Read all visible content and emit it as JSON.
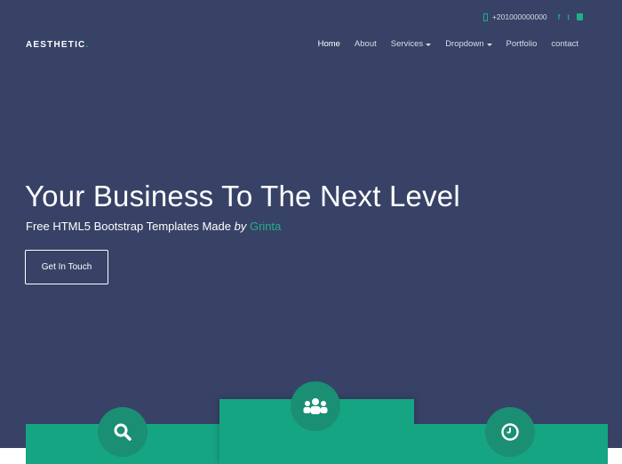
{
  "topbar": {
    "phone": "+201000000000",
    "social": [
      "f",
      "t"
    ]
  },
  "brand": {
    "name": "AESTHETIC",
    "dot": "."
  },
  "nav": {
    "items": [
      {
        "label": "Home",
        "active": true,
        "dropdown": false
      },
      {
        "label": "About",
        "active": false,
        "dropdown": false
      },
      {
        "label": "Services",
        "active": false,
        "dropdown": true
      },
      {
        "label": "Dropdown",
        "active": false,
        "dropdown": true
      },
      {
        "label": "Portfolio",
        "active": false,
        "dropdown": false
      },
      {
        "label": "contact",
        "active": false,
        "dropdown": false
      }
    ]
  },
  "hero": {
    "title": "Your Business To The Next Level",
    "subtitle_prefix": "Free HTML5 Bootstrap Templates Made ",
    "subtitle_by": "by",
    "subtitle_brand": "Grinta",
    "cta_label": "Get In Touch"
  },
  "features": {
    "icons": [
      "search-icon",
      "users-icon",
      "clock-icon"
    ]
  },
  "colors": {
    "background": "#374266",
    "accent": "#16a583",
    "accent_dark": "#1a8f73",
    "text": "#ffffff"
  }
}
